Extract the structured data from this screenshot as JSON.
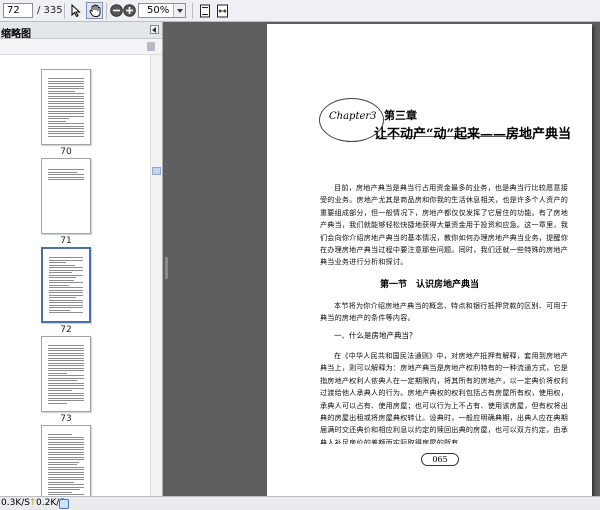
{
  "toolbar": {
    "page_value": "72",
    "page_total": "/ 335",
    "zoom": "50%",
    "icons": [
      "select-cursor-icon",
      "hand-tool-icon",
      "zoom-out-icon",
      "zoom-in-icon",
      "fit-page-icon",
      "fit-width-icon"
    ]
  },
  "sidebar": {
    "title": "缩略图",
    "thumbnails": [
      {
        "label": "70"
      },
      {
        "label": "71"
      },
      {
        "label": "72"
      },
      {
        "label": "73"
      }
    ]
  },
  "document": {
    "chapter_en": "Chapter3",
    "chapter_cn": "第三章",
    "chapter_title": "让不动产“动”起来——房地产典当",
    "intro": "目前，房地产典当是典当行占用资金最多的业务，也是典当行比较愿意接受的业务。房地产尤其是商品房和你我的生活休息相关，也是许多个人资产的重要组成部分，但一般情况下，房地产都仅仅发挥了它居住的功能。有了房地产典当，我们就能够轻松快捷地获得大量资金用于投资和应急。这一章里，我们会向你介绍房地产典当的基本情况，教你如何办理房地产典当业务，提醒你在办理房地产典当过程中要注意那些问题。同时，我们还就一些特殊的房地产典当业务进行分析和探讨。",
    "section_title": "第一节　认识房地产典当",
    "section_intro": "本节将为你介绍房地产典当的概念、特点和银行抵押贷款的区别、可用于典当的房地产的条件等内容。",
    "question": "一、什么是房地产典当？",
    "answer": "在《中华人民共和国民法通则》中，对房地产抵押有解释，套用到房地产典当上，则可以解释为：房地产典当是房地产权利特有的一种流通方式，它是指房地产权利人依典人在一定期限内，将其所有的房地产，以一定典价将权利过渡给他人承典人的行为。房地产典权的权利包括占有房屋所有权，使用权，承典人可以占有、使用房屋；也可以行为上不占有、使用该房屋，但有权将出典的房屋出租或将房屋典权转让。设典时，一般应明确典期，出典人应在典期届满时交还典价和相应利息以约定的赎回出典的房屋，也可以双方约定，由承典人补足房价的差额而实际取得房屋的所有",
    "page_number": "065"
  },
  "status": {
    "speed_a": "0.3K/S",
    "speed_b": "0.2K/S"
  }
}
